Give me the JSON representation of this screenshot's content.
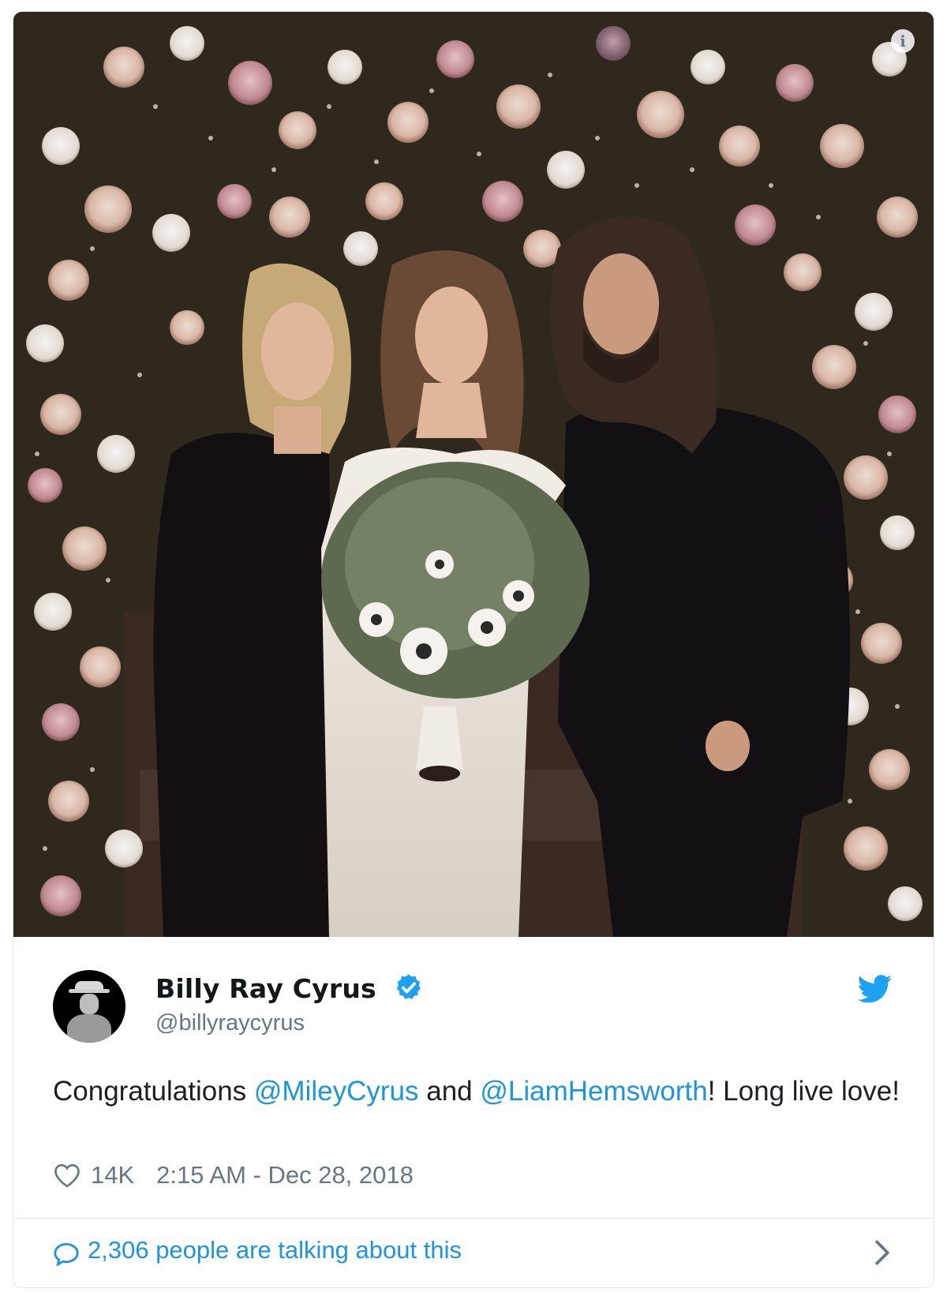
{
  "tweet": {
    "author_name": "Billy Ray Cyrus",
    "author_handle": "@billyraycyrus",
    "verified": true,
    "text_parts": {
      "p1": "Congratulations ",
      "m1": "@MileyCyrus",
      "p2": " and ",
      "m2": "@LiamHemsworth",
      "p3": "! Long live love!"
    },
    "likes": "14K",
    "timestamp": "2:15 AM - Dec 28, 2018",
    "talking": "2,306 people are talking about this"
  },
  "icons": {
    "info": "info-icon",
    "verified": "verified-badge-icon",
    "brand": "twitter-bird-icon",
    "like": "heart-icon",
    "reply": "speech-bubble-icon",
    "more": "chevron-right-icon"
  },
  "colors": {
    "link": "#1b95e0",
    "text": "#1c2022",
    "muted": "#657786",
    "border": "#e1e8ed"
  }
}
